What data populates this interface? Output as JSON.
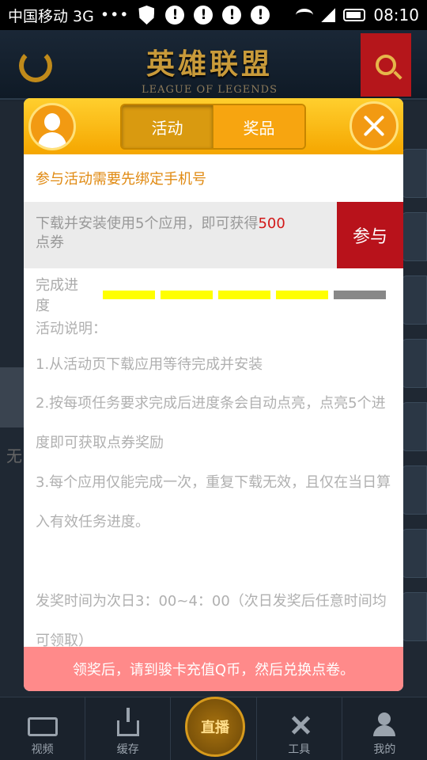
{
  "status_bar": {
    "carrier": "中国移动 3G",
    "dots": "•••",
    "notification_glyph": "!",
    "time": "08:10"
  },
  "header": {
    "logo_cn": "英雄联盟",
    "logo_en": "LEAGUE OF LEGENDS"
  },
  "modal": {
    "tabs": [
      {
        "label": "活动",
        "active": true
      },
      {
        "label": "奖品",
        "active": false
      }
    ],
    "bind_notice": "参与活动需要先绑定手机号",
    "task": {
      "text_before": "下载并安装使用5个应用，即可获得",
      "highlight": "500",
      "text_after": "点券",
      "join_label": "参与"
    },
    "progress": {
      "label": "完成进度",
      "completed": 4,
      "total": 5,
      "done_color": "#ffff00",
      "todo_color": "#888888"
    },
    "description": {
      "title": "活动说明：",
      "items": [
        "1.从活动页下载应用等待完成并安装",
        "2.按每项任务要求完成后进度条会自动点亮，点亮5个进度即可获取点券奖励",
        "3.每个应用仅能完成一次，重复下载无效，且仅在当日算入有效任务进度。"
      ],
      "award_time": "发奖时间为次日3：00~4：00（次日发奖后任意时间均可领取）"
    },
    "footer_note": "领奖后，请到骏卡充值Q币，然后兑换点卷。"
  },
  "background": {
    "partial_text": "无"
  },
  "bottom_nav": {
    "items": [
      {
        "label": "视频",
        "icon": "tv-icon"
      },
      {
        "label": "缓存",
        "icon": "download-icon"
      },
      {
        "label": "直播",
        "icon": "live-icon"
      },
      {
        "label": "工具",
        "icon": "tools-icon"
      },
      {
        "label": "我的",
        "icon": "user-icon"
      }
    ]
  }
}
